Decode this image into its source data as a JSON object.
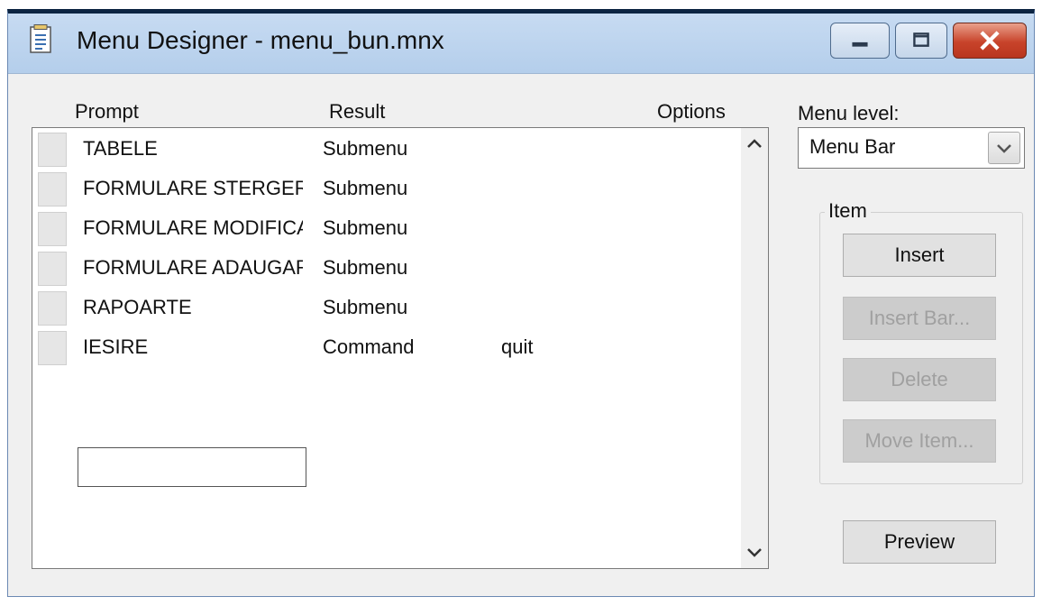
{
  "window": {
    "title": "Menu Designer - menu_bun.mnx"
  },
  "icons": {
    "app": "menu-document-icon",
    "minimize": "minimize-icon",
    "maximize": "maximize-icon",
    "close": "close-icon",
    "scroll_up": "chevron-up-icon",
    "scroll_down": "chevron-down-icon",
    "dropdown": "chevron-down-icon"
  },
  "columns": {
    "prompt": "Prompt",
    "result": "Result",
    "options": "Options"
  },
  "rows": [
    {
      "prompt": "TABELE",
      "result": "Submenu",
      "options": ""
    },
    {
      "prompt": "FORMULARE STERGERE",
      "result": "Submenu",
      "options": ""
    },
    {
      "prompt": "FORMULARE MODIFICARE",
      "result": "Submenu",
      "options": ""
    },
    {
      "prompt": "FORMULARE ADAUGARE",
      "result": "Submenu",
      "options": ""
    },
    {
      "prompt": "RAPOARTE",
      "result": "Submenu",
      "options": ""
    },
    {
      "prompt": "IESIRE",
      "result": "Command",
      "options": "quit"
    }
  ],
  "new_item": {
    "value": ""
  },
  "menu_level": {
    "label": "Menu level:",
    "selected": "Menu Bar"
  },
  "item_group": {
    "label": "Item",
    "insert": "Insert",
    "insert_bar": "Insert Bar...",
    "delete": "Delete",
    "move_item": "Move Item..."
  },
  "preview": "Preview",
  "colors": {
    "titlebar": "#b9d1ea",
    "close_button": "#c8432a",
    "window_bg": "#f0f0f0"
  }
}
